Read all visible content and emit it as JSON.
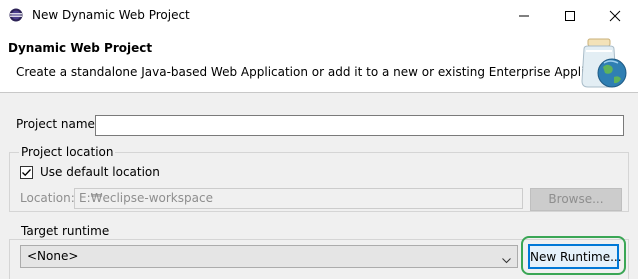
{
  "window": {
    "title": "New Dynamic Web Project",
    "icons": {
      "app": "eclipse-icon",
      "minimize": "minimize-icon",
      "maximize": "maximize-icon",
      "close": "close-icon"
    }
  },
  "banner": {
    "title": "Dynamic Web Project",
    "description": "Create a standalone Java-based Web Application or add it to a new or existing Enterprise Application.",
    "icon": "web-project-jar-globe-icon"
  },
  "form": {
    "project_name": {
      "label": "Project name:",
      "value": ""
    },
    "project_location": {
      "group_label": "Project location",
      "use_default": {
        "label": "Use default location",
        "checked": true
      },
      "location": {
        "label": "Location:",
        "value": "E:₩eclipse-workspace",
        "disabled": true
      },
      "browse_label": "Browse..."
    },
    "target_runtime": {
      "group_label": "Target runtime",
      "selected": "<None>",
      "new_runtime_label": "New Runtime..."
    }
  },
  "colors": {
    "highlight": "#3aa655",
    "focus_border": "#0078d7"
  }
}
